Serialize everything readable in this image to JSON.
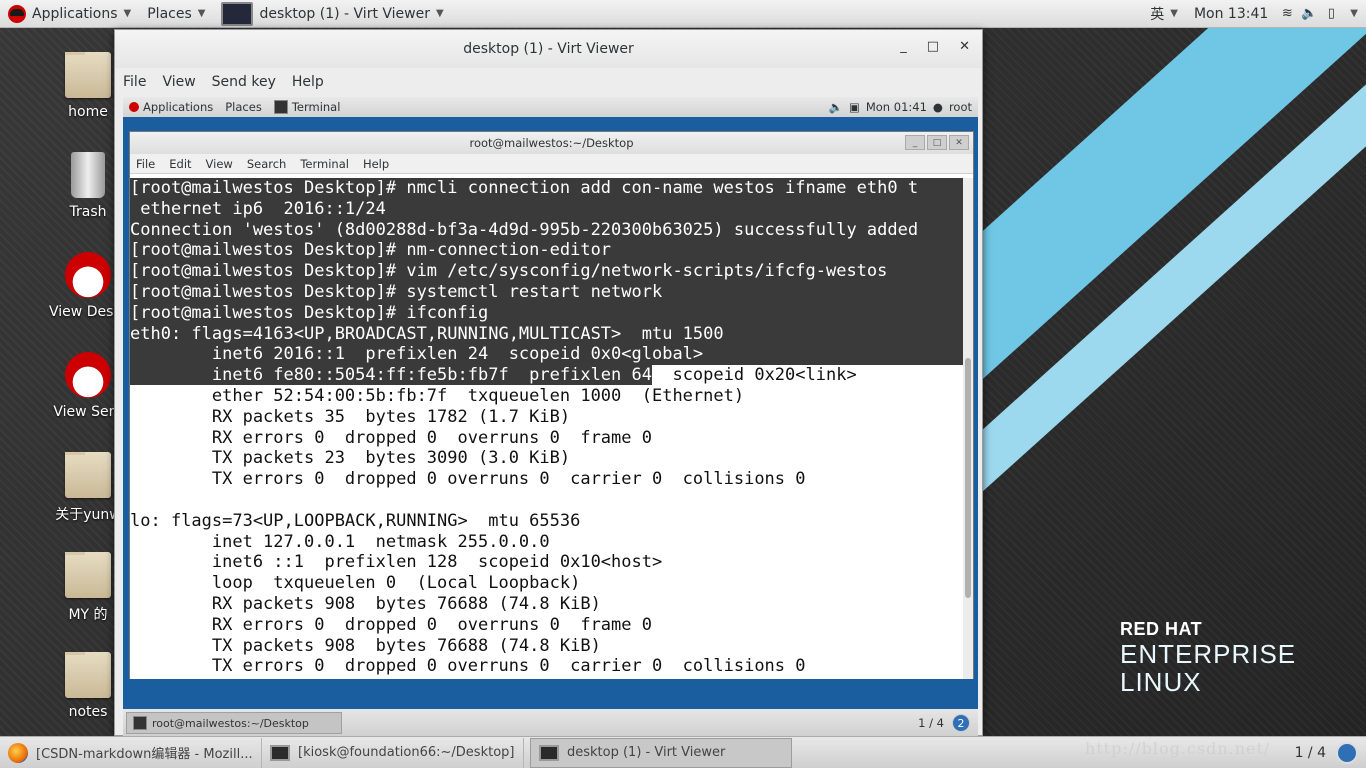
{
  "topbar": {
    "applications": "Applications",
    "places": "Places",
    "active_window": "desktop (1) - Virt Viewer",
    "input_method": "英",
    "clock": "Mon 13:41"
  },
  "desktop_icons": [
    {
      "label": "home",
      "icon": "home-folder-icon"
    },
    {
      "label": "Trash",
      "icon": "trash-icon"
    },
    {
      "label": "View Deskt",
      "icon": "redhat-icon"
    },
    {
      "label": "View Serv",
      "icon": "redhat-icon"
    },
    {
      "label": "关于yunw",
      "icon": "folder-icon"
    },
    {
      "label": "MY 的",
      "icon": "folder-icon"
    },
    {
      "label": "notes",
      "icon": "folder-icon"
    }
  ],
  "virt_viewer": {
    "title": "desktop (1) - Virt Viewer",
    "menu": [
      "File",
      "View",
      "Send key",
      "Help"
    ]
  },
  "guest": {
    "applications": "Applications",
    "places": "Places",
    "task": "Terminal",
    "clock": "Mon 01:41",
    "user": "root",
    "terminal_title": "root@mailwestos:~/Desktop",
    "terminal_menu": [
      "File",
      "Edit",
      "View",
      "Search",
      "Terminal",
      "Help"
    ],
    "terminal_lines": [
      {
        "text": "[root@mailwestos Desktop]# nmcli connection add con-name westos ifname eth0 t",
        "sel": "full"
      },
      {
        "text": " ethernet ip6  2016::1/24",
        "sel": "full"
      },
      {
        "text": "Connection 'westos' (8d00288d-bf3a-4d9d-995b-220300b63025) successfully added",
        "sel": "full"
      },
      {
        "text": "[root@mailwestos Desktop]# nm-connection-editor",
        "sel": "full"
      },
      {
        "text": "[root@mailwestos Desktop]# vim /etc/sysconfig/network-scripts/ifcfg-westos",
        "sel": "full"
      },
      {
        "text": "[root@mailwestos Desktop]# systemctl restart network",
        "sel": "full"
      },
      {
        "text": "[root@mailwestos Desktop]# ifconfig",
        "sel": "full"
      },
      {
        "text": "eth0: flags=4163<UP,BROADCAST,RUNNING,MULTICAST>  mtu 1500",
        "sel": "full"
      },
      {
        "text": "        inet6 2016::1  prefixlen 24  scopeid 0x0<global>",
        "sel": "full"
      },
      {
        "text": "        inet6 fe80::5054:ff:fe5b:fb7f  prefixlen 64",
        "sel": "full",
        "rest": "  scopeid 0x20<link>"
      },
      {
        "text": "        ether 52:54:00:5b:fb:7f  txqueuelen 1000  (Ethernet)",
        "sel": "none"
      },
      {
        "text": "        RX packets 35  bytes 1782 (1.7 KiB)",
        "sel": "none"
      },
      {
        "text": "        RX errors 0  dropped 0  overruns 0  frame 0",
        "sel": "none"
      },
      {
        "text": "        TX packets 23  bytes 3090 (3.0 KiB)",
        "sel": "none"
      },
      {
        "text": "        TX errors 0  dropped 0 overruns 0  carrier 0  collisions 0",
        "sel": "none"
      },
      {
        "text": "",
        "sel": "none"
      },
      {
        "text": "lo: flags=73<UP,LOOPBACK,RUNNING>  mtu 65536",
        "sel": "none"
      },
      {
        "text": "        inet 127.0.0.1  netmask 255.0.0.0",
        "sel": "none"
      },
      {
        "text": "        inet6 ::1  prefixlen 128  scopeid 0x10<host>",
        "sel": "none"
      },
      {
        "text": "        loop  txqueuelen 0  (Local Loopback)",
        "sel": "none"
      },
      {
        "text": "        RX packets 908  bytes 76688 (74.8 KiB)",
        "sel": "none"
      },
      {
        "text": "        RX errors 0  dropped 0  overruns 0  frame 0",
        "sel": "none"
      },
      {
        "text": "        TX packets 908  bytes 76688 (74.8 KiB)",
        "sel": "none"
      },
      {
        "text": "        TX errors 0  dropped 0 overruns 0  carrier 0  collisions 0",
        "sel": "none"
      }
    ],
    "bottom_task": "root@mailwestos:~/Desktop",
    "workspace": "1 / 4"
  },
  "branding": {
    "line1": "RED HAT",
    "line2": "ENTERPRISE",
    "line3": "LINUX"
  },
  "bottombar": {
    "tasks": [
      {
        "label": "[CSDN-markdown编辑器 - Mozill...",
        "icon": "firefox-icon"
      },
      {
        "label": "[kiosk@foundation66:~/Desktop]",
        "icon": "terminal-icon"
      },
      {
        "label": "desktop (1) - Virt Viewer",
        "icon": "monitor-icon"
      }
    ],
    "workspace": "1 / 4"
  },
  "watermark": "http://blog.csdn.net/"
}
